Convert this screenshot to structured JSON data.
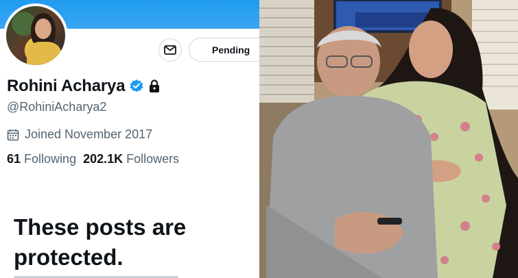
{
  "profile": {
    "name": "Rohini Acharya",
    "handle": "@RohiniAcharya2",
    "joined": "Joined November 2017",
    "following_count": "61",
    "following_label": "Following",
    "followers_count": "202.1K",
    "followers_label": "Followers"
  },
  "actions": {
    "pending_label": "Pending"
  },
  "protected_notice": {
    "heading": "These posts are protected."
  },
  "colors": {
    "banner": "#1f9bf0",
    "verified": "#1d9bf0",
    "text_primary": "#0f1419",
    "text_secondary": "#536471"
  },
  "icons": {
    "message": "envelope-icon",
    "verified": "verified-badge-icon",
    "protected": "lock-icon",
    "joined": "calendar-icon"
  }
}
